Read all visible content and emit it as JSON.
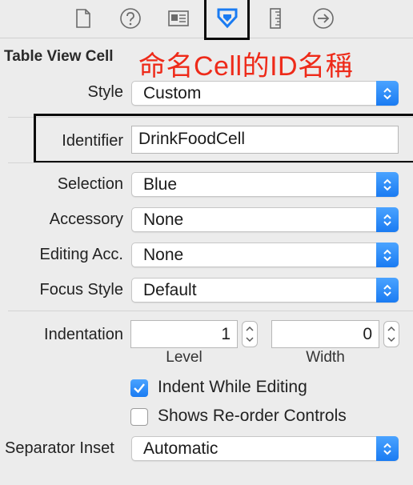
{
  "toolbar": {
    "icons": [
      "file-inspector-icon",
      "quick-help-icon",
      "identity-inspector-icon",
      "attributes-inspector-icon",
      "size-inspector-icon",
      "connections-inspector-icon"
    ],
    "accent": "#1a7bf2"
  },
  "section": {
    "title": "Table View Cell"
  },
  "annotation": {
    "text": "命名Cell的ID名稱",
    "color": "#ee2a19"
  },
  "fields": {
    "style": {
      "label": "Style",
      "value": "Custom"
    },
    "identifier": {
      "label": "Identifier",
      "value": "DrinkFoodCell"
    },
    "selection": {
      "label": "Selection",
      "value": "Blue"
    },
    "accessory": {
      "label": "Accessory",
      "value": "None"
    },
    "editing_accessory": {
      "label": "Editing Acc.",
      "value": "None"
    },
    "focus_style": {
      "label": "Focus Style",
      "value": "Default"
    },
    "indentation": {
      "label": "Indentation",
      "level": "1",
      "level_label": "Level",
      "width": "0",
      "width_label": "Width"
    },
    "indent_while_editing": {
      "label": "Indent While Editing",
      "checked": true
    },
    "shows_reorder": {
      "label": "Shows Re-order Controls",
      "checked": false
    },
    "separator_inset": {
      "label": "Separator Inset",
      "value": "Automatic"
    }
  }
}
